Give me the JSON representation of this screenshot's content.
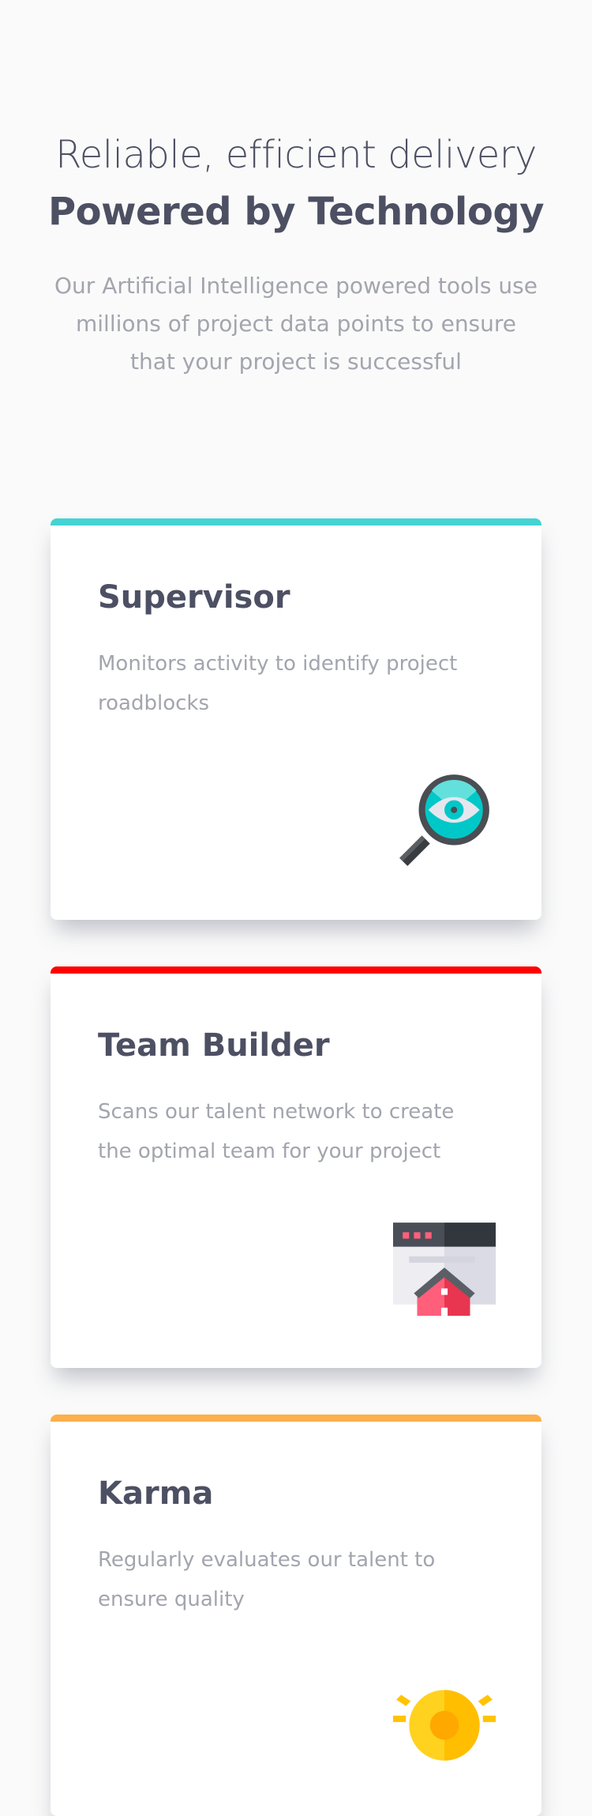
{
  "hero": {
    "title_light": "Reliable, efficient delivery",
    "title_bold": "Powered by Technology",
    "description": "Our Artificial Intelligence powered tools use millions of project data points to ensure that your project is successful"
  },
  "cards": [
    {
      "title": "Supervisor",
      "description": "Monitors activity to identify project roadblocks",
      "accent": "#44d3d2",
      "icon": "magnifier-eye-icon"
    },
    {
      "title": "Team Builder",
      "description": "Scans our talent network to create the optimal team for your project",
      "accent": "#ff0000",
      "icon": "browser-home-icon"
    },
    {
      "title": "Karma",
      "description": "Regularly evaluates our talent to ensure quality",
      "accent": "#fcaf4a",
      "icon": "sun-gear-icon"
    }
  ]
}
